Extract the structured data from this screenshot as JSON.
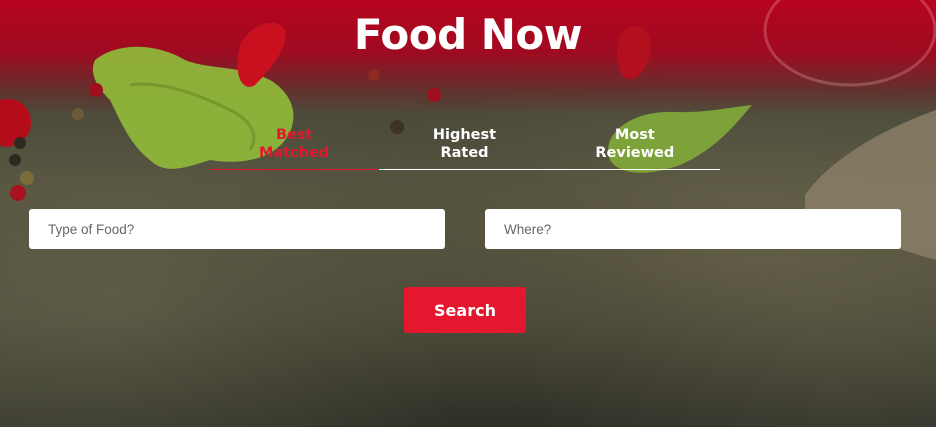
{
  "header": {
    "title": "Food Now"
  },
  "tabs": [
    {
      "label_line1": "Best",
      "label_line2": "Matched",
      "active": true
    },
    {
      "label_line1": "Highest",
      "label_line2": "Rated",
      "active": false
    },
    {
      "label_line1": "Most",
      "label_line2": "Reviewed",
      "active": false
    }
  ],
  "search": {
    "food_placeholder": "Type of Food?",
    "food_value": "",
    "where_placeholder": "Where?",
    "where_value": "",
    "button_label": "Search"
  },
  "colors": {
    "accent": "#e5172f",
    "header_band": "#be001e",
    "background": "#4a4a3c",
    "text_light": "#ffffff"
  }
}
